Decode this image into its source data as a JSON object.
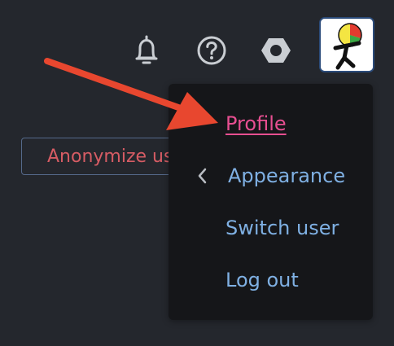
{
  "header": {
    "icons": {
      "notifications": "bell-icon",
      "help": "question-circle-icon",
      "settings": "hexagon-settings-icon"
    },
    "avatar": "user-avatar"
  },
  "main": {
    "anonymize_button_label": "Anonymize us"
  },
  "user_menu": {
    "items": [
      {
        "label": "Profile",
        "state": "active"
      },
      {
        "label": "Appearance",
        "has_submenu": true
      },
      {
        "label": "Switch user"
      },
      {
        "label": "Log out"
      }
    ]
  },
  "colors": {
    "background": "#24272d",
    "menu_background": "#151619",
    "menu_link": "#7fb0e3",
    "menu_active": "#e74f91",
    "button_text": "#d65c64",
    "annotation_arrow": "#e8472f"
  }
}
